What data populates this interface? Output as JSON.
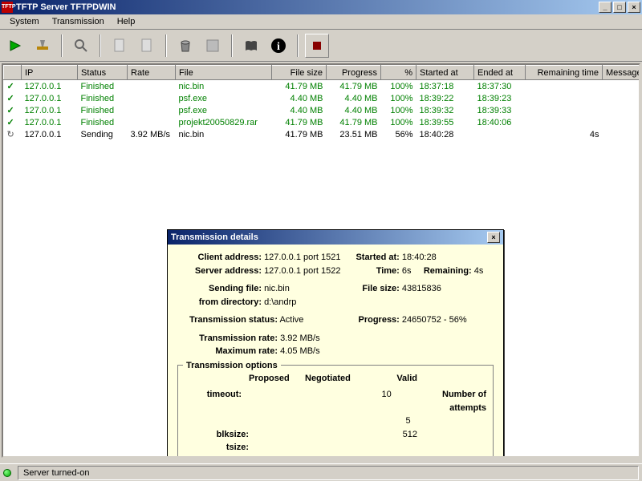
{
  "window": {
    "title": "TFTP Server TFTPDWIN"
  },
  "menu": {
    "system": "System",
    "transmission": "Transmission",
    "help": "Help"
  },
  "toolbar": {
    "play": "play-icon",
    "setup": "setup-icon",
    "find": "find-icon",
    "copy": "copy-icon",
    "paste": "paste-icon",
    "trash": "trash-icon",
    "save": "save-icon",
    "book": "book-icon",
    "info": "info-icon",
    "stop": "stop-icon"
  },
  "columns": [
    "",
    "IP",
    "Status",
    "Rate",
    "File",
    "File size",
    "Progress",
    "%",
    "Started at",
    "Ended at",
    "Remaining time",
    "Message"
  ],
  "rows": [
    {
      "state": "finished",
      "icon": "✓",
      "ip": "127.0.0.1",
      "status": "Finished",
      "rate": "",
      "file": "nic.bin",
      "size": "41.79 MB",
      "progress": "41.79 MB",
      "pct": "100%",
      "start": "18:37:18",
      "end": "18:37:30",
      "remain": "",
      "msg": ""
    },
    {
      "state": "finished",
      "icon": "✓",
      "ip": "127.0.0.1",
      "status": "Finished",
      "rate": "",
      "file": "psf.exe",
      "size": "4.40 MB",
      "progress": "4.40 MB",
      "pct": "100%",
      "start": "18:39:22",
      "end": "18:39:23",
      "remain": "",
      "msg": ""
    },
    {
      "state": "finished",
      "icon": "✓",
      "ip": "127.0.0.1",
      "status": "Finished",
      "rate": "",
      "file": "psf.exe",
      "size": "4.40 MB",
      "progress": "4.40 MB",
      "pct": "100%",
      "start": "18:39:32",
      "end": "18:39:33",
      "remain": "",
      "msg": ""
    },
    {
      "state": "finished",
      "icon": "✓",
      "ip": "127.0.0.1",
      "status": "Finished",
      "rate": "",
      "file": "projekt20050829.rar",
      "size": "41.79 MB",
      "progress": "41.79 MB",
      "pct": "100%",
      "start": "18:39:55",
      "end": "18:40:06",
      "remain": "",
      "msg": ""
    },
    {
      "state": "sending",
      "icon": "↻",
      "ip": "127.0.0.1",
      "status": "Sending",
      "rate": "3.92 MB/s",
      "file": "nic.bin",
      "size": "41.79 MB",
      "progress": "23.51 MB",
      "pct": "56%",
      "start": "18:40:28",
      "end": "",
      "remain": "4s",
      "msg": ""
    }
  ],
  "dialog": {
    "title": "Transmission details",
    "labels": {
      "client_addr": "Client address:",
      "server_addr": "Server address:",
      "sending_file": "Sending file:",
      "from_dir": "from directory:",
      "status": "Transmission status:",
      "rate": "Transmission rate:",
      "maxrate": "Maximum rate:",
      "started": "Started at:",
      "time": "Time:",
      "remaining": "Remaining:",
      "filesize": "File size:",
      "progress": "Progress:",
      "options": "Transmission options",
      "proposed": "Proposed",
      "negotiated": "Negotiated",
      "valid": "Valid",
      "timeout": "timeout:",
      "blksize": "blksize:",
      "tsize": "tsize:",
      "attempts": "Number of attempts"
    },
    "values": {
      "client_addr": "127.0.0.1 port 1521",
      "server_addr": "127.0.0.1 port 1522",
      "sending_file": "nic.bin",
      "from_dir": "d:\\andrp",
      "status": "Active",
      "rate": "3.92 MB/s",
      "maxrate": "4.05 MB/s",
      "started": "18:40:28",
      "time": "6s",
      "remaining": "4s",
      "filesize": "43815836",
      "progress": "24650752 - 56%",
      "timeout_valid": "10",
      "blksize_valid": "512",
      "attempts": "5"
    }
  },
  "status": {
    "led": "on",
    "text": "Server turned-on"
  }
}
